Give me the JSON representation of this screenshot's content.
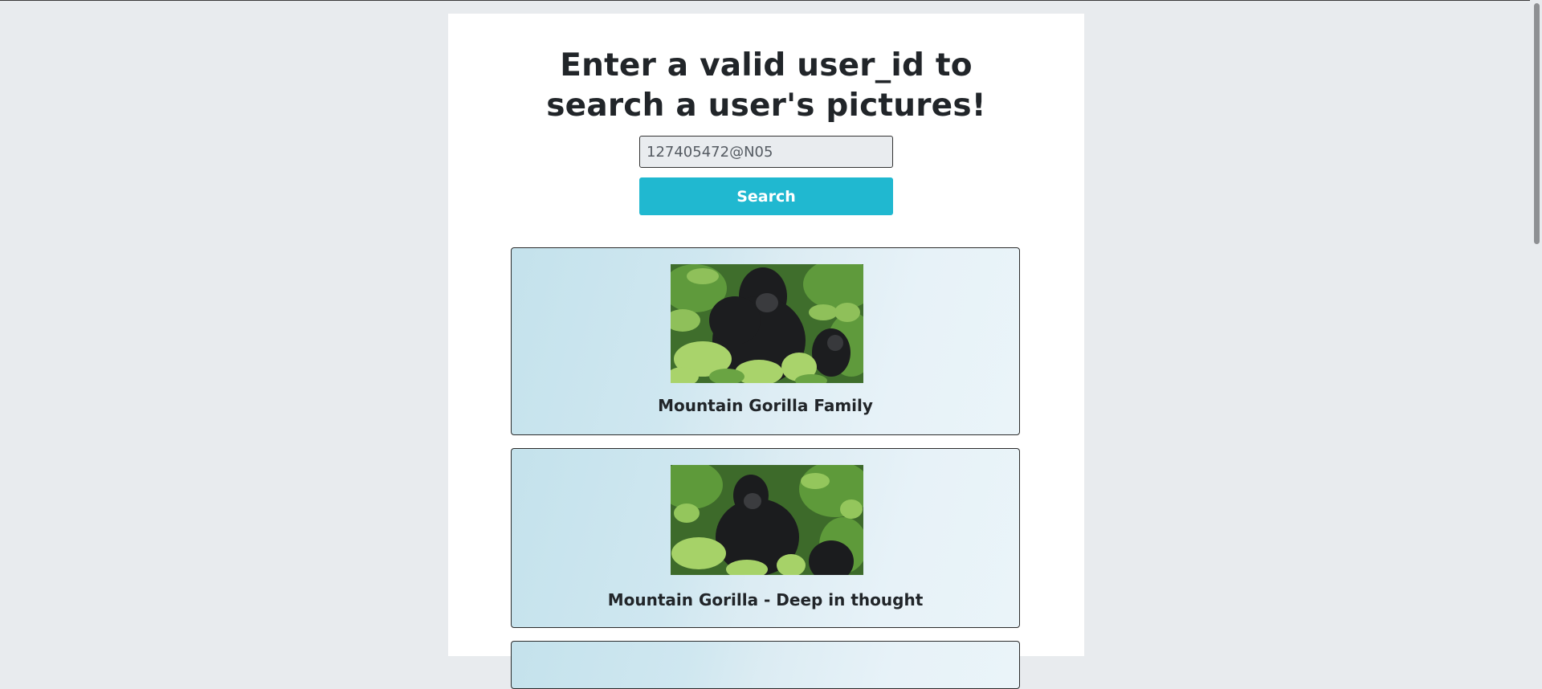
{
  "search": {
    "heading_line1": "Enter a valid user_id to",
    "heading_line2": "search a user's pictures!",
    "input_value": "127405472@N05",
    "button_label": "Search"
  },
  "photos": [
    {
      "title": "Mountain Gorilla Family",
      "image": "gorilla-family-photo"
    },
    {
      "title": "Mountain Gorilla - Deep in thought",
      "image": "gorilla-thinking-photo"
    }
  ],
  "colors": {
    "background": "#e8ebee",
    "panel": "#ffffff",
    "button": "#20b8d0",
    "card_gradient_start": "#c4e2ec",
    "card_gradient_end": "#eaf4f9"
  }
}
